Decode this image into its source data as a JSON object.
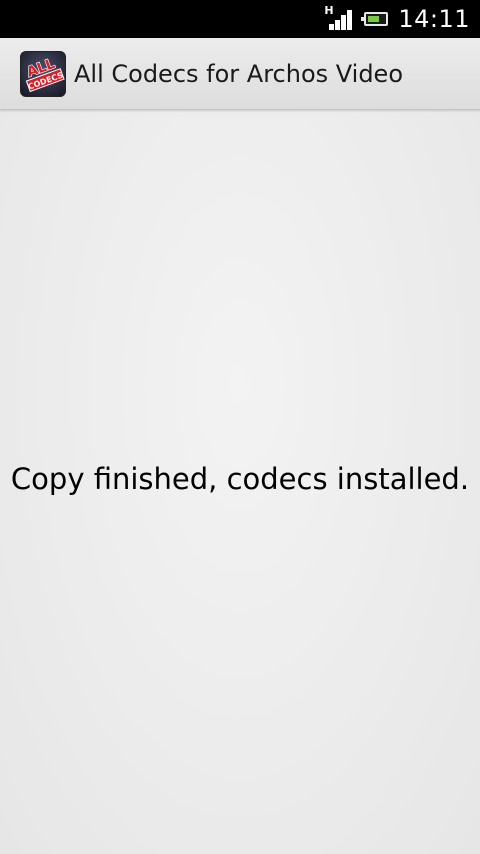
{
  "status_bar": {
    "network_type": "H",
    "time": "14:11",
    "signal_icon": "signal-icon",
    "battery_icon": "battery-icon"
  },
  "action_bar": {
    "app_icon": "all-codecs-app-icon",
    "app_icon_text_top": "ALL",
    "app_icon_text_bottom": "CODECS",
    "title": "All Codecs for Archos Video"
  },
  "content": {
    "message": "Copy finished, codecs installed."
  },
  "colors": {
    "status_bar_bg": "#000000",
    "action_bar_bg": "#e3e3e3",
    "content_bg": "#eeeeee",
    "text": "#000000",
    "battery_fill": "#7ac943",
    "app_icon_red": "#d4202a"
  }
}
